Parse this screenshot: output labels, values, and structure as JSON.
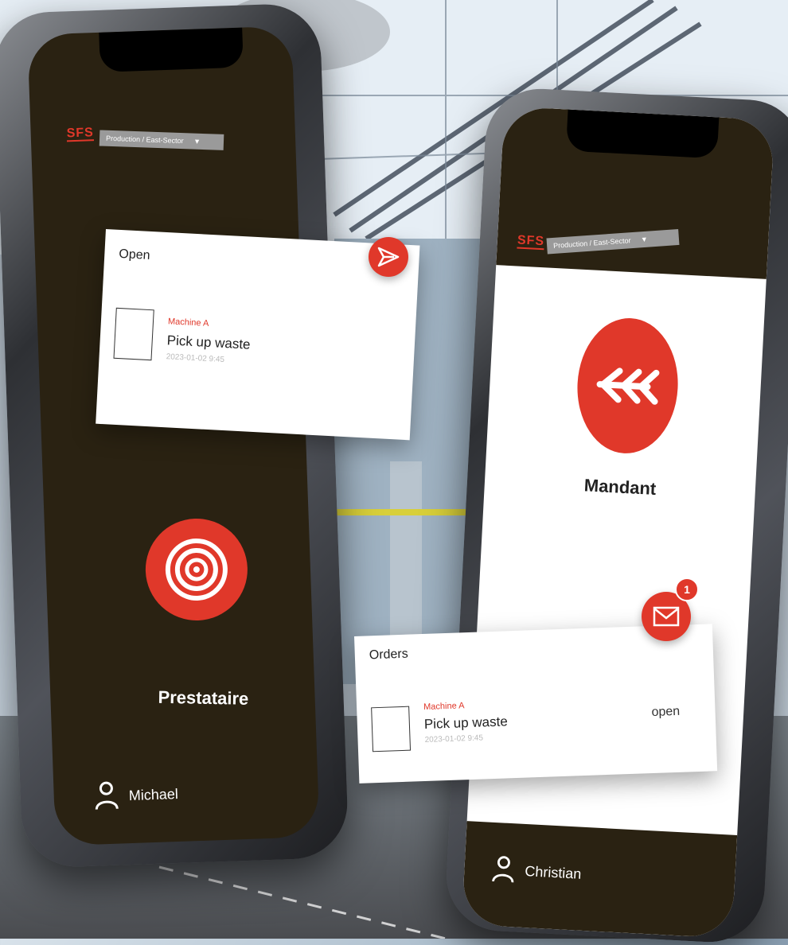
{
  "left_phone": {
    "logo": "SFS",
    "sector_label": "Production / East-Sector",
    "sector_caret": "▼",
    "role_label": "Prestataire",
    "role_icon": "target-icon",
    "user_name": "Michael",
    "card": {
      "title": "Open",
      "machine": "Machine A",
      "task": "Pick up waste",
      "date": "2023-01-02 9:45",
      "action_icon": "send-icon"
    }
  },
  "right_phone": {
    "logo": "SFS",
    "sector_label": "Production / East-Sector",
    "sector_caret": "▼",
    "role_label": "Mandant",
    "role_icon": "double-arrow-left-icon",
    "user_name": "Christian",
    "card": {
      "title": "Orders",
      "machine": "Machine A",
      "task": "Pick up waste",
      "date": "2023-01-02 9:45",
      "status": "open",
      "action_icon": "mail-icon",
      "badge_count": "1"
    }
  },
  "colors": {
    "accent": "#e0382a",
    "screen_dark": "#2a2212",
    "card_bg": "#ffffff"
  }
}
